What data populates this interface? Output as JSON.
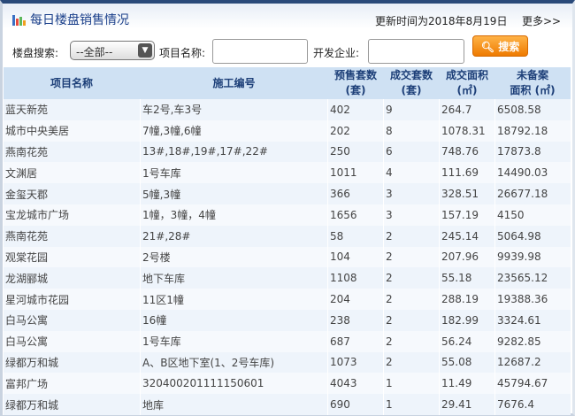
{
  "header": {
    "title": "每日楼盘销售情况",
    "updated": "更新时间为2018年8月19日",
    "more": "更多>>"
  },
  "search": {
    "label_building": "楼盘搜索:",
    "select_value": "--全部--",
    "label_project": "项目名称:",
    "project_value": "",
    "label_developer": "开发企业:",
    "developer_value": "",
    "button": "搜索"
  },
  "colors": {
    "accent": "#1a3f8a",
    "button": "#ee7a00",
    "header_bg": "#cfe1f3"
  },
  "table": {
    "headers": [
      {
        "l1": "项目名称",
        "l2": ""
      },
      {
        "l1": "施工编号",
        "l2": ""
      },
      {
        "l1": "预售套数",
        "l2": "(套)"
      },
      {
        "l1": "成交套数",
        "l2": "(套)"
      },
      {
        "l1": "成交面积",
        "l2": "(㎡)"
      },
      {
        "l1": "未备案",
        "l2": "面积 (㎡)"
      }
    ],
    "rows": [
      [
        "蓝天新苑",
        "车2号,车3号",
        "402",
        "9",
        "264.7",
        "6508.58"
      ],
      [
        "城市中央美居",
        "7幢,3幢,6幢",
        "202",
        "8",
        "1078.31",
        "18792.18"
      ],
      [
        "燕南花苑",
        "13#,18#,19#,17#,22#",
        "250",
        "6",
        "748.76",
        "17873.8"
      ],
      [
        "文渊居",
        "1号车库",
        "1011",
        "4",
        "111.69",
        "14490.03"
      ],
      [
        "金玺天郡",
        "5幢,3幢",
        "366",
        "3",
        "328.51",
        "26677.18"
      ],
      [
        "宝龙城市广场",
        "1幢，3幢，4幢",
        "1656",
        "3",
        "157.19",
        "4150"
      ],
      [
        "燕南花苑",
        "21#,28#",
        "58",
        "2",
        "245.14",
        "5064.98"
      ],
      [
        "观棠花园",
        "2号楼",
        "104",
        "2",
        "207.96",
        "9939.98"
      ],
      [
        "龙湖郦城",
        "地下车库",
        "1108",
        "2",
        "55.18",
        "23565.12"
      ],
      [
        "星河城市花园",
        "11区1幢",
        "204",
        "2",
        "288.19",
        "19388.36"
      ],
      [
        "白马公寓",
        "16幢",
        "238",
        "2",
        "182.99",
        "3324.61"
      ],
      [
        "白马公寓",
        "1号车库",
        "687",
        "2",
        "56.24",
        "9282.85"
      ],
      [
        "绿都万和城",
        "A、B区地下室(1、2号车库)",
        "1073",
        "2",
        "55.08",
        "12687.2"
      ],
      [
        "富邦广场",
        "320400201111150601",
        "4043",
        "1",
        "11.49",
        "45794.67"
      ],
      [
        "绿都万和城",
        "地库",
        "690",
        "1",
        "29.41",
        "7676.4"
      ]
    ]
  }
}
